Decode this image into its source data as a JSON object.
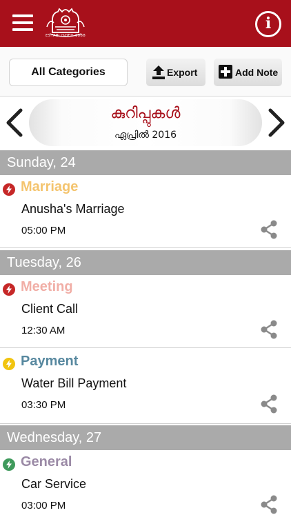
{
  "header": {
    "logo_text": "ESTABLISHED 1888",
    "info_label": "i",
    "bg_color": "#a8101b"
  },
  "toolbar": {
    "category_label": "All Categories",
    "export_label": "Export",
    "add_note_label": "Add Note"
  },
  "month_nav": {
    "title": "കുറിപ്പുകൾ",
    "subtitle": "ഏപ്രിൽ 2016"
  },
  "days": [
    {
      "label": "Sunday, 24",
      "events": [
        {
          "category": "Marriage",
          "category_color": "#f4c46e",
          "dot_color": "#c62828",
          "title": "Anusha's Marriage",
          "time": "05:00 PM"
        }
      ]
    },
    {
      "label": "Tuesday, 26",
      "events": [
        {
          "category": "Meeting",
          "category_color": "#f1aea6",
          "dot_color": "#c62828",
          "title": "Client Call",
          "time": "12:30 AM"
        },
        {
          "category": "Payment",
          "category_color": "#57889f",
          "dot_color": "#f1c40f",
          "title": "Water Bill Payment",
          "time": "03:30 PM"
        }
      ]
    },
    {
      "label": "Wednesday, 27",
      "events": [
        {
          "category": "General",
          "category_color": "#9b8aa6",
          "dot_color": "#3f9a5c",
          "title": "Car Service",
          "time": "03:00 PM"
        }
      ]
    }
  ],
  "icons": {
    "menu": "hamburger-icon",
    "info": "info-icon",
    "export": "upload-icon",
    "add_note": "plus-box-icon",
    "prev": "chevron-left-icon",
    "next": "chevron-right-icon",
    "share": "share-icon",
    "category": "lightning-icon"
  }
}
